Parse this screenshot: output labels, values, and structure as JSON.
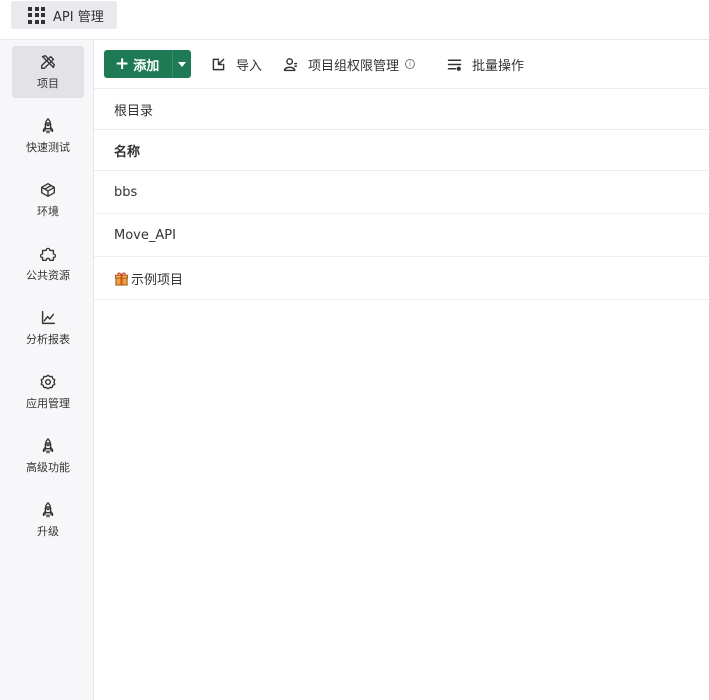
{
  "app": {
    "title": "API 管理"
  },
  "sidebar": {
    "items": [
      {
        "label": "项目",
        "icon": "pencil-ruler-icon",
        "active": true
      },
      {
        "label": "快速测试",
        "icon": "rocket-icon"
      },
      {
        "label": "环境",
        "icon": "cube-icon"
      },
      {
        "label": "公共资源",
        "icon": "puzzle-icon"
      },
      {
        "label": "分析报表",
        "icon": "chart-line-icon"
      },
      {
        "label": "应用管理",
        "icon": "gear-icon"
      },
      {
        "label": "高级功能",
        "icon": "rocket-icon"
      },
      {
        "label": "升级",
        "icon": "rocket-icon"
      }
    ]
  },
  "toolbar": {
    "add_label": "添加",
    "import_label": "导入",
    "permission_label": "项目组权限管理",
    "batch_label": "批量操作"
  },
  "breadcrumb": {
    "root": "根目录"
  },
  "table": {
    "header": "名称",
    "rows": [
      {
        "name": "bbs"
      },
      {
        "name": "Move_API"
      },
      {
        "name": "示例项目",
        "icon": "gift-icon"
      }
    ]
  },
  "colors": {
    "primary": "#1e7a54",
    "sidebar_bg": "#f7f7f9",
    "active_bg": "#e3e3e7"
  }
}
